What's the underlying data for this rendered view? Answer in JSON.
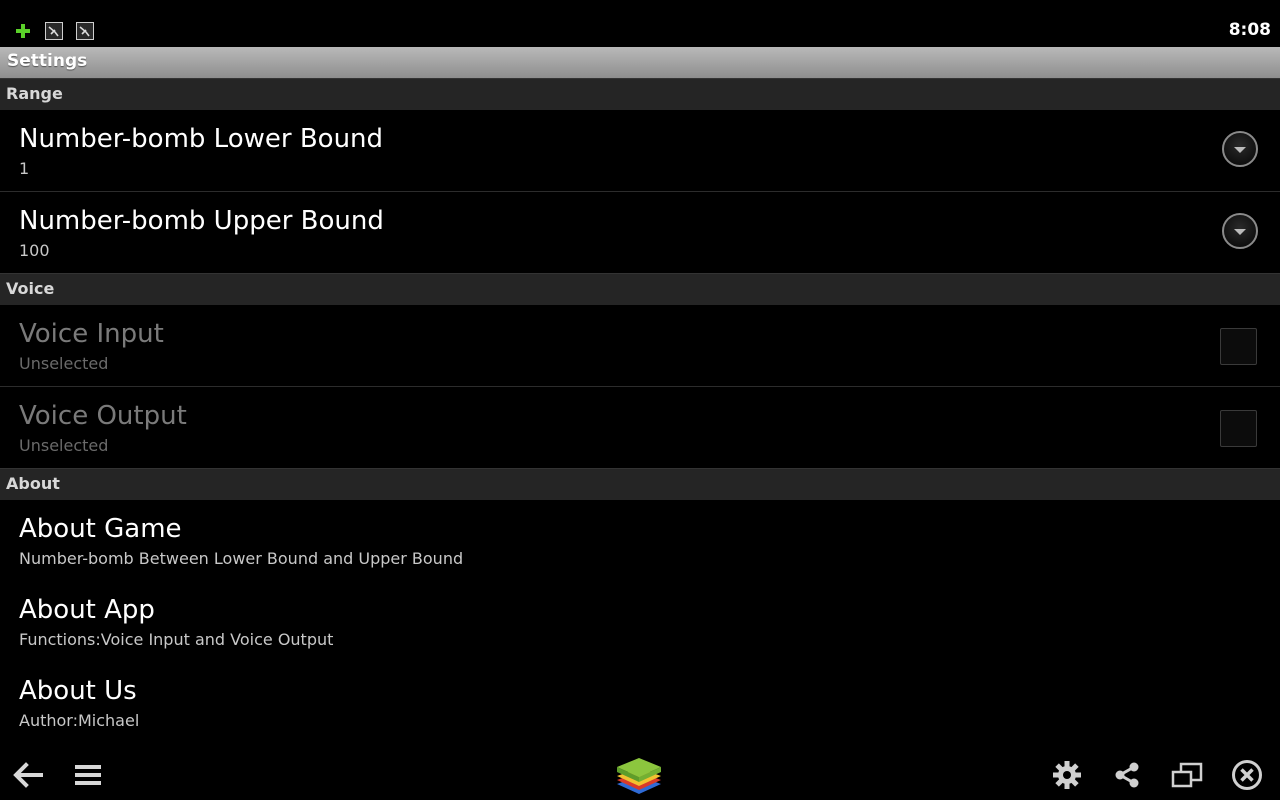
{
  "status_bar": {
    "time": "8:08",
    "icons": [
      "add-icon",
      "notification-icon",
      "notification-icon"
    ]
  },
  "title_bar": {
    "title": "Settings"
  },
  "categories": {
    "range": "Range",
    "voice": "Voice",
    "about": "About"
  },
  "preferences": {
    "lower_bound": {
      "title": "Number-bomb Lower Bound",
      "summary": "1"
    },
    "upper_bound": {
      "title": "Number-bomb Upper Bound",
      "summary": "100"
    },
    "voice_input": {
      "title": "Voice Input",
      "summary": "Unselected"
    },
    "voice_output": {
      "title": "Voice Output",
      "summary": "Unselected"
    },
    "about_game": {
      "title": "About Game",
      "summary": "Number-bomb Between Lower Bound and Upper Bound"
    },
    "about_app": {
      "title": "About App",
      "summary": "Functions:Voice Input and Voice Output"
    },
    "about_us": {
      "title": "About Us",
      "summary": "Author:Michael"
    }
  },
  "nav_icons": [
    "back-icon",
    "menu-icon",
    "app-logo-icon",
    "settings-icon",
    "share-icon",
    "window-icon",
    "close-icon"
  ],
  "colors": {
    "background": "#000000",
    "title_bar": "#a5a5a5",
    "category_bg": "#252525"
  }
}
